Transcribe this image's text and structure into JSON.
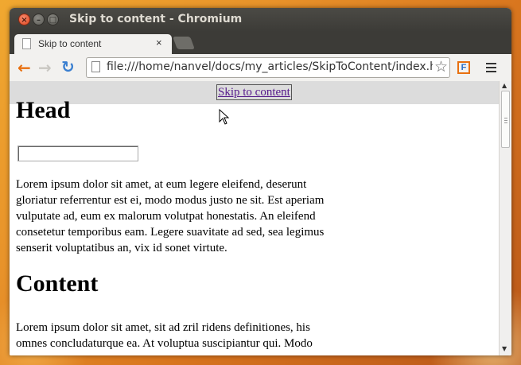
{
  "window": {
    "title": "Skip to content - Chromium",
    "controls": {
      "close": "×",
      "minimize": "–",
      "maximize": "□"
    }
  },
  "tab": {
    "title": "Skip to content",
    "close": "×"
  },
  "toolbar": {
    "back_icon": "←",
    "forward_icon": "→",
    "reload_icon": "↻",
    "url": "file:///home/nanvel/docs/my_articles/SkipToContent/index.h",
    "star_icon": "☆",
    "extension_label": "F"
  },
  "page": {
    "skip_link": "Skip to content",
    "heading1": "Head",
    "paragraph1": "Lorem ipsum dolor sit amet, at eum legere eleifend, deserunt gloriatur referrentur est ei, modo modus justo ne sit. Est aperiam vulputate ad, eum ex malorum volutpat honestatis. An eleifend consetetur temporibus eam. Legere suavitate ad sed, sea legimus senserit voluptatibus an, vix id sonet virtute.",
    "heading2": "Content",
    "paragraph2": "Lorem ipsum dolor sit amet, sit ad zril ridens definitiones, his omnes concludaturque ea. At voluptua suscipiantur qui. Modo"
  },
  "scrollbar": {
    "up_arrow": "▲",
    "down_arrow": "▼"
  },
  "colors": {
    "accent_orange": "#e8700f",
    "link_visited": "#551a8b",
    "titlebar": "#3c3b37"
  }
}
